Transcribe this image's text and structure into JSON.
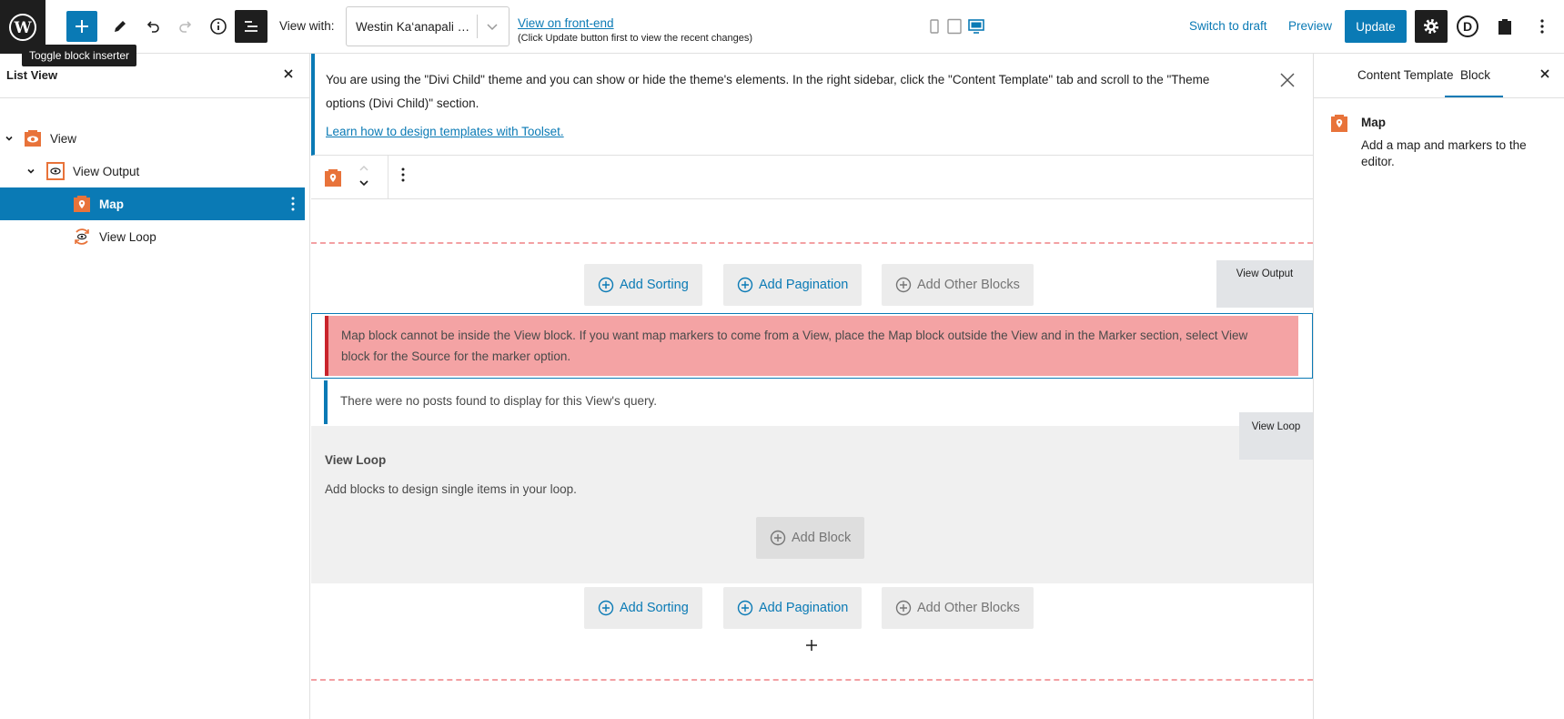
{
  "toolbar": {
    "tooltip": "Toggle block inserter",
    "view_with_label": "View with:",
    "view_with_value": "Westin Ka‘anapali O...",
    "view_frontend_link": "View on front-end",
    "view_frontend_note": "(Click Update button first to view the recent changes)",
    "switch_to_draft": "Switch to draft",
    "preview": "Preview",
    "update": "Update",
    "avatar_letter": "D"
  },
  "listview": {
    "title": "List View",
    "items": [
      {
        "label": "View"
      },
      {
        "label": "View Output"
      },
      {
        "label": "Map"
      },
      {
        "label": "View Loop"
      }
    ]
  },
  "notice": {
    "text": "You are using the \"Divi Child\" theme and you can show or hide the theme's elements. In the right sidebar, click the \"Content Template\" tab and scroll to the \"Theme options (Divi Child)\" section.",
    "link": "Learn how to design templates with Toolset."
  },
  "canvas": {
    "top_buttons": {
      "add_sorting": "Add Sorting",
      "add_pagination": "Add Pagination",
      "add_other_blocks": "Add Other Blocks"
    },
    "view_output_tag": "View Output",
    "map_error": "Map block cannot be inside the View block. If you want map markers to come from a View, place the Map block outside the View and in the Marker section, select View block for the Source for the marker option.",
    "no_posts": "There were no posts found to display for this View's query.",
    "view_loop_tag": "View Loop",
    "loop_title": "View Loop",
    "loop_desc": "Add blocks to design single items in your loop.",
    "add_block": "Add Block",
    "bottom_buttons": {
      "add_sorting": "Add Sorting",
      "add_pagination": "Add Pagination",
      "add_other_blocks": "Add Other Blocks"
    }
  },
  "settings": {
    "tab_content_template": "Content Template",
    "tab_block": "Block",
    "active_tab": "Block",
    "block_title": "Map",
    "block_desc": "Add a map and markers to the editor."
  },
  "colors": {
    "accent": "#0a7ab5",
    "block_icon": "#e8733a",
    "error_bg": "#f4a3a4",
    "error_border": "#c9232b"
  },
  "icons": [
    "wordpress-logo",
    "plus-icon",
    "pencil-icon",
    "undo-icon",
    "redo-icon",
    "info-icon",
    "list-view-icon",
    "chevron-down-icon",
    "mobile-icon",
    "tablet-icon",
    "desktop-icon",
    "gear-icon",
    "avatar-icon",
    "toolset-icon",
    "kebab-icon",
    "close-icon",
    "map-block-icon",
    "view-block-icon",
    "loop-icon",
    "add-circle-icon"
  ]
}
